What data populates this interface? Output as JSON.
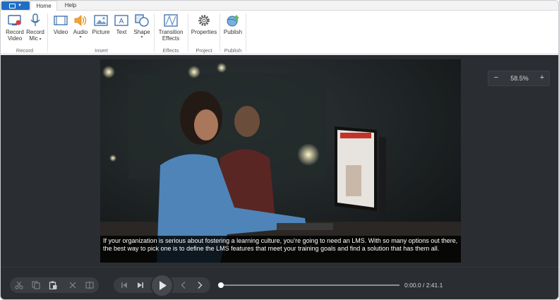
{
  "tabs": {
    "home": "Home",
    "help": "Help"
  },
  "ribbon": {
    "record_video": [
      "Record",
      "Video"
    ],
    "record_mic": [
      "Record",
      "Mic"
    ],
    "video": "Video",
    "audio": "Audio",
    "picture": "Picture",
    "text": "Text",
    "shape": "Shape",
    "transition": [
      "Transition",
      "Effects"
    ],
    "properties": "Properties",
    "publish": "Publish",
    "groups": {
      "record": "Record",
      "insert": "Insert",
      "effects": "Effects",
      "project": "Project",
      "publish": "Publish"
    }
  },
  "zoom": {
    "value": "58.5%",
    "minus": "−",
    "plus": "+"
  },
  "caption": "If your organization is serious about fostering a learning culture, you’re going to need an LMS. With so many options out there, the best way to pick one is to define the LMS features that meet your training goals and find a solution that has them all.",
  "playback": {
    "current": "0:00.0",
    "total": "2:41.1",
    "time_display": "0:00.0 / 2:41.1",
    "progress_fraction": 0.0
  },
  "colors": {
    "accent": "#1f6fc5",
    "stage": "#2a2d32",
    "audio_icon": "#f2a43a",
    "publish_icon": "#5cb85c"
  }
}
